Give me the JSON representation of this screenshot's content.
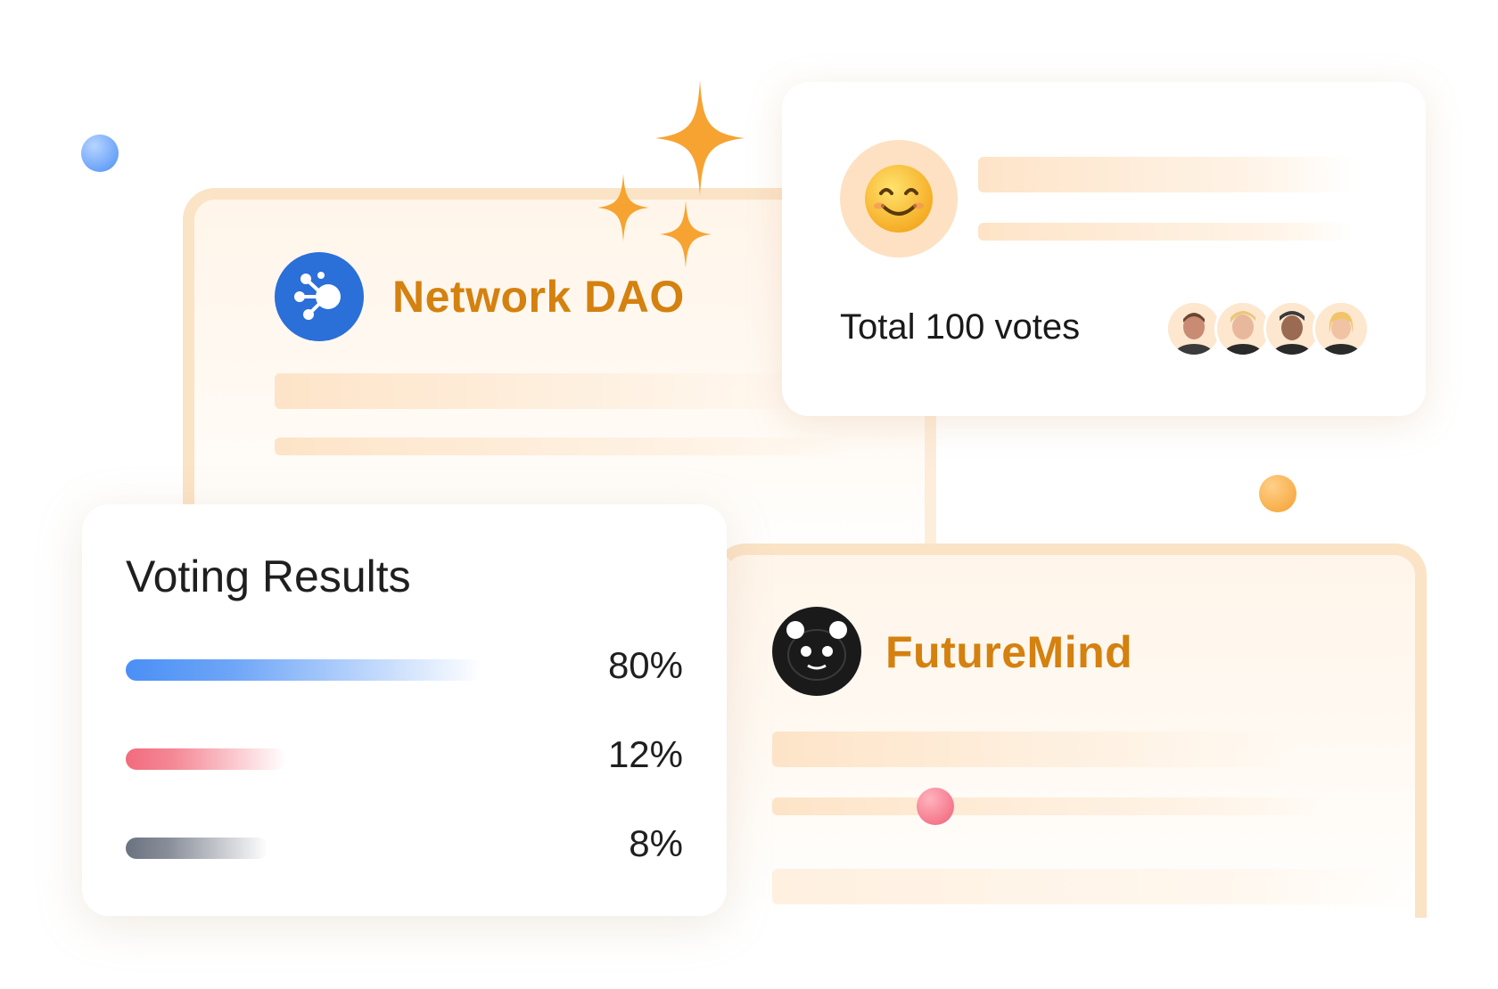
{
  "network_dao": {
    "name": "Network DAO"
  },
  "future_mind": {
    "name": "FutureMind"
  },
  "vote_card": {
    "total_votes": "Total 100 votes",
    "avatars": [
      "avatar-1",
      "avatar-2",
      "avatar-3",
      "avatar-4"
    ]
  },
  "results": {
    "title": "Voting Results",
    "items": [
      {
        "percent": "80%",
        "fraction": 0.8,
        "color": "#4a8ff5"
      },
      {
        "percent": "12%",
        "fraction": 0.12,
        "color": "#f26b7c"
      },
      {
        "percent": "8%",
        "fraction": 0.08,
        "color": "#6b7280"
      }
    ]
  },
  "colors": {
    "accent": "#d4810f",
    "card_border": "#fbe3c6",
    "sparkle": "#f7a331"
  }
}
